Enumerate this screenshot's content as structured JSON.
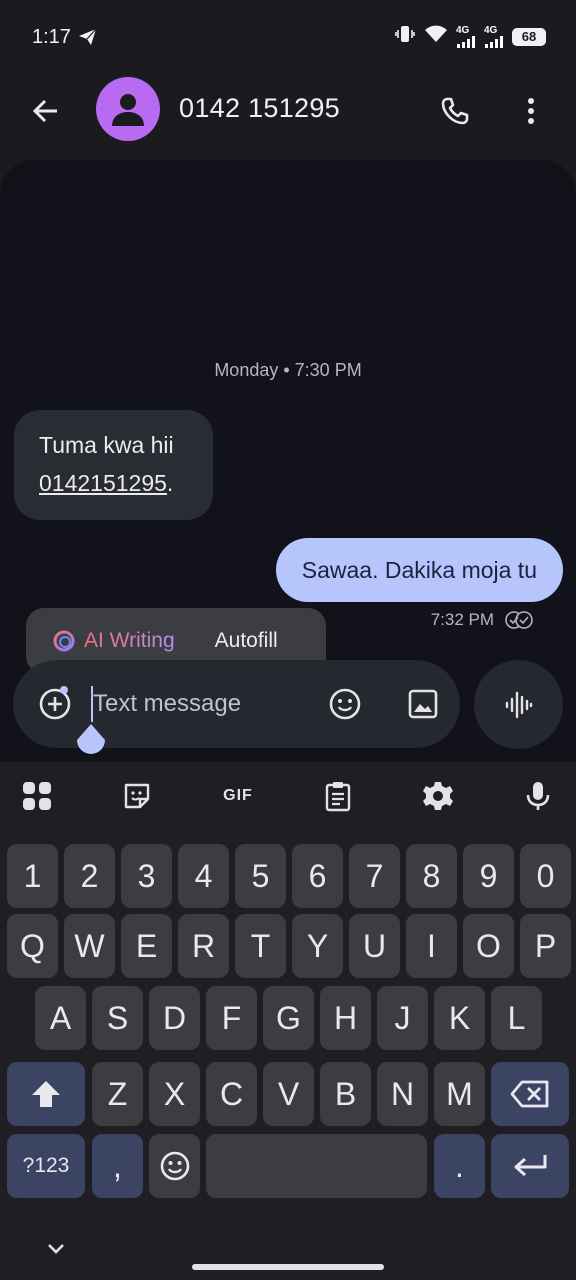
{
  "status_bar": {
    "time": "1:17",
    "network_1": "4G",
    "network_2": "4G",
    "battery": "68"
  },
  "header": {
    "contact_name": "0142 151295"
  },
  "conversation": {
    "date_separator": "Monday • 7:30 PM",
    "incoming": {
      "text_before": "Tuma kwa hii",
      "link": "0142151295",
      "text_after": "."
    },
    "outgoing": {
      "text": "Sawaa. Dakika moja tu",
      "time": "7:32 PM"
    }
  },
  "ai_popup": {
    "ai_writing_label": "AI Writing",
    "autofill_label": "Autofill"
  },
  "composer": {
    "placeholder": "Text message"
  },
  "keyboard": {
    "gif_label": "GIF",
    "row_numbers": [
      "1",
      "2",
      "3",
      "4",
      "5",
      "6",
      "7",
      "8",
      "9",
      "0"
    ],
    "row_q": [
      "Q",
      "W",
      "E",
      "R",
      "T",
      "Y",
      "U",
      "I",
      "O",
      "P"
    ],
    "row_a": [
      "A",
      "S",
      "D",
      "F",
      "G",
      "H",
      "J",
      "K",
      "L"
    ],
    "row_z": [
      "Z",
      "X",
      "C",
      "V",
      "B",
      "N",
      "M"
    ],
    "symbols_label": "?123",
    "comma_label": ",",
    "period_label": "."
  },
  "colors": {
    "accent_outgoing": "#b6c5fb",
    "avatar": "#b86bf0",
    "background": "#12131a",
    "special_key": "#3b4563"
  }
}
